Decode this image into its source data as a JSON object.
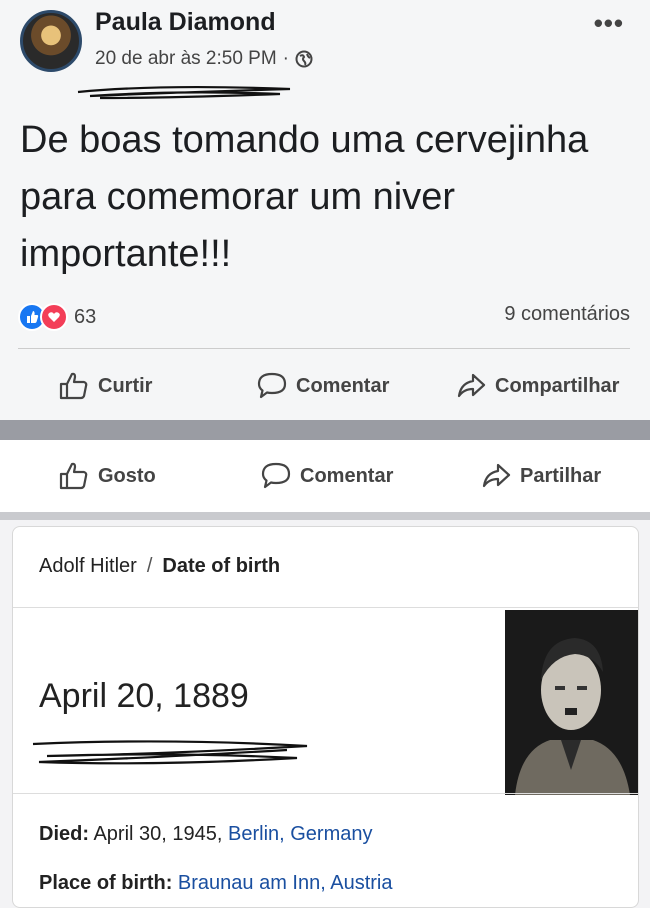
{
  "post": {
    "author": "Paula Diamond",
    "timestamp": "20 de abr às 2:50 PM",
    "separator": "·",
    "privacy_icon": "globe-icon",
    "more_icon": "more-options-icon",
    "text": "De boas tomando uma cervejinha para comemorar um niver importante!!!",
    "reaction_count": "63",
    "comments_count": "9 comentários",
    "actions": {
      "like": "Curtir",
      "comment": "Comentar",
      "share": "Compartilhar"
    }
  },
  "post2_actions": {
    "like": "Gosto",
    "comment": "Comentar",
    "share": "Partilhar"
  },
  "info_card": {
    "breadcrumb_entity": "Adolf Hitler",
    "breadcrumb_separator": "/",
    "breadcrumb_current": "Date of birth",
    "date_of_birth": "April 20, 1889",
    "died_label": "Died:",
    "died_date": "April 30, 1945,",
    "died_place": "Berlin, Germany",
    "birthplace_label": "Place of birth:",
    "birthplace_value": "Braunau am Inn, Austria"
  },
  "colors": {
    "like_blue": "#1877f2",
    "love_red": "#f33e58",
    "link_blue": "#1a4fa0",
    "band_gray": "#9a9ca3"
  }
}
